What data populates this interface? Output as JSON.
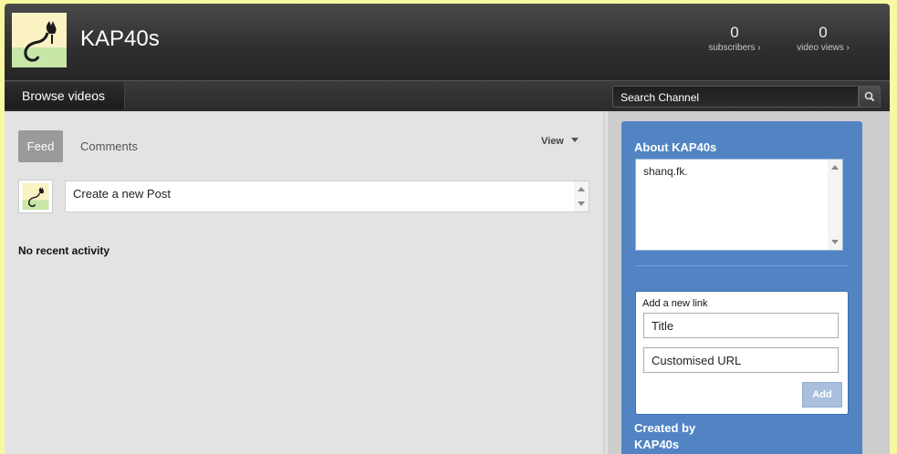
{
  "header": {
    "channel_name": "KAP40s",
    "subscribers": {
      "count": "0",
      "label": "subscribers ›"
    },
    "video_views": {
      "count": "0",
      "label": "video views ›"
    }
  },
  "navbar": {
    "browse_label": "Browse videos",
    "search_placeholder": "Search Channel"
  },
  "feed": {
    "tabs": [
      {
        "label": "Feed",
        "active": true
      },
      {
        "label": "Comments",
        "active": false
      }
    ],
    "view_label": "View",
    "post_placeholder": "Create a new Post",
    "empty_message": "No recent activity"
  },
  "about": {
    "title": "About KAP40s",
    "description": "shanq.fk.",
    "add_link": {
      "label": "Add a new link",
      "title_placeholder": "Title",
      "url_placeholder": "Customised URL",
      "add_label": "Add"
    },
    "created_by_label": "Created by",
    "created_by_name": "KAP40s"
  },
  "colors": {
    "header_dark": "#2e2e2e",
    "about_panel": "#5284c4",
    "avatar_bg_top": "#fbf2c4",
    "avatar_bg_bottom": "#c7e6a8"
  },
  "icons": {
    "search": "magnifier-icon",
    "avatar": "cat-silhouette-icon"
  }
}
